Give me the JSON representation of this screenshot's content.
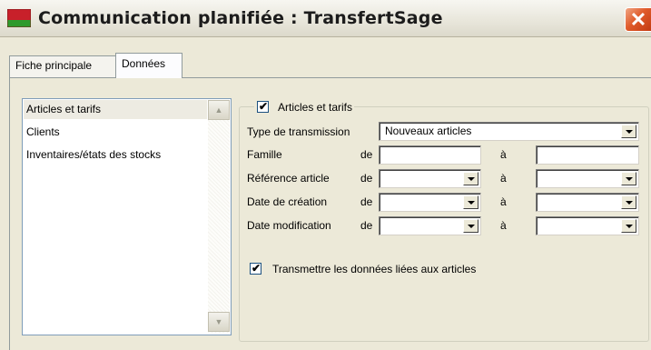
{
  "window": {
    "title": "Communication planifiée : TransfertSage",
    "close_glyph": "✕",
    "icon": "app-flag-icon"
  },
  "tabs": [
    {
      "label": "Fiche principale",
      "active": false
    },
    {
      "label": "Données",
      "active": true
    }
  ],
  "category_list": {
    "items": [
      {
        "label": "Articles et tarifs",
        "selected": true
      },
      {
        "label": "Clients",
        "selected": false
      },
      {
        "label": "Inventaires/états des stocks",
        "selected": false
      }
    ],
    "scroll_up_glyph": "▲",
    "scroll_down_glyph": "▼"
  },
  "articles_group": {
    "legend": "Articles et tarifs",
    "legend_checked": true,
    "type_transmission": {
      "label": "Type de transmission",
      "value": "Nouveaux articles"
    },
    "de_label": "de",
    "a_label": "à",
    "rows": {
      "famille": {
        "label": "Famille",
        "from": "",
        "to": ""
      },
      "reference": {
        "label": "Référence article",
        "from": "",
        "to": ""
      },
      "date_creation": {
        "label": "Date de création",
        "from": "",
        "to": ""
      },
      "date_modification": {
        "label": "Date modification",
        "from": "",
        "to": ""
      }
    },
    "transmit_linked": {
      "label": "Transmettre les données liées aux articles",
      "checked": true
    },
    "check_glyph": "✔"
  },
  "colors": {
    "dialog_bg": "#ECE9D8",
    "selection": "#EDEBE2",
    "close_button": "#D8552A",
    "field_border": "#7F9DB9"
  }
}
